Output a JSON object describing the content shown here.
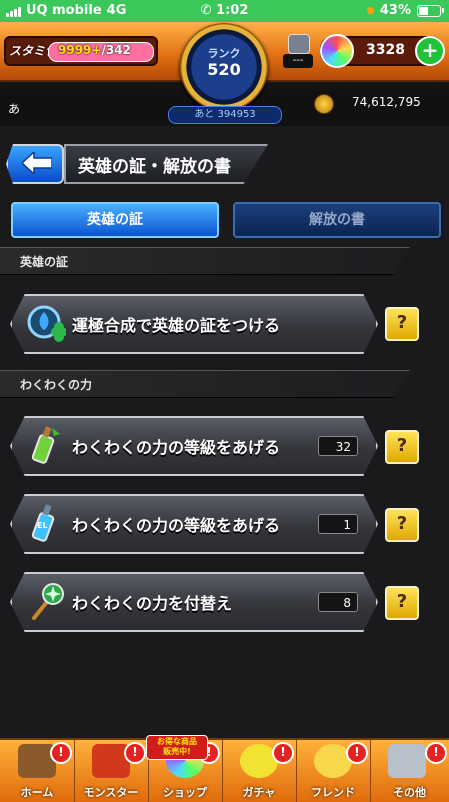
{
  "status_bar": {
    "carrier": "UQ mobile",
    "network": "4G",
    "time": "1:02",
    "battery": "43%"
  },
  "hud": {
    "stamina_label": "スタミナ",
    "stamina_current": "9999+",
    "stamina_max": "/342",
    "rank_label": "ランク",
    "rank_value": "520",
    "rank_next": "あと 394953",
    "badge_value": "---",
    "orb_count": "3328",
    "player_name": "あ",
    "gold": "74,612,795"
  },
  "header": {
    "title": "英雄の証・解放の書"
  },
  "tabs": [
    {
      "label": "英雄の証",
      "active": true
    },
    {
      "label": "解放の書",
      "active": false
    }
  ],
  "sections": [
    {
      "title": "英雄の証",
      "items": [
        {
          "label": "運極合成で英雄の証をつける",
          "icon": "hero-badge-clover-icon"
        }
      ]
    },
    {
      "title": "わくわくの力",
      "items": [
        {
          "label": "わくわくの力の等級をあげる",
          "count": "32",
          "icon": "green-potion-icon"
        },
        {
          "label": "わくわくの力の等級をあげる",
          "count": "1",
          "icon": "el-potion-icon"
        },
        {
          "label": "わくわくの力を付替え",
          "count": "8",
          "icon": "magic-wand-icon"
        }
      ]
    }
  ],
  "help_label": "?",
  "bottom_nav": {
    "promo_text_1": "お得な商品",
    "promo_text_2": "販売中!",
    "items": [
      {
        "label": "ホーム",
        "alert": "!"
      },
      {
        "label": "モンスター",
        "alert": "!"
      },
      {
        "label": "ショップ",
        "alert": "!"
      },
      {
        "label": "ガチャ",
        "alert": "!"
      },
      {
        "label": "フレンド",
        "alert": "!"
      },
      {
        "label": "その他",
        "alert": "!"
      }
    ]
  },
  "colors": {
    "accent_orange": "#e06d12",
    "tab_active": "#0a53d0",
    "help_yellow": "#e0a800",
    "status_green": "#3bc85a"
  }
}
